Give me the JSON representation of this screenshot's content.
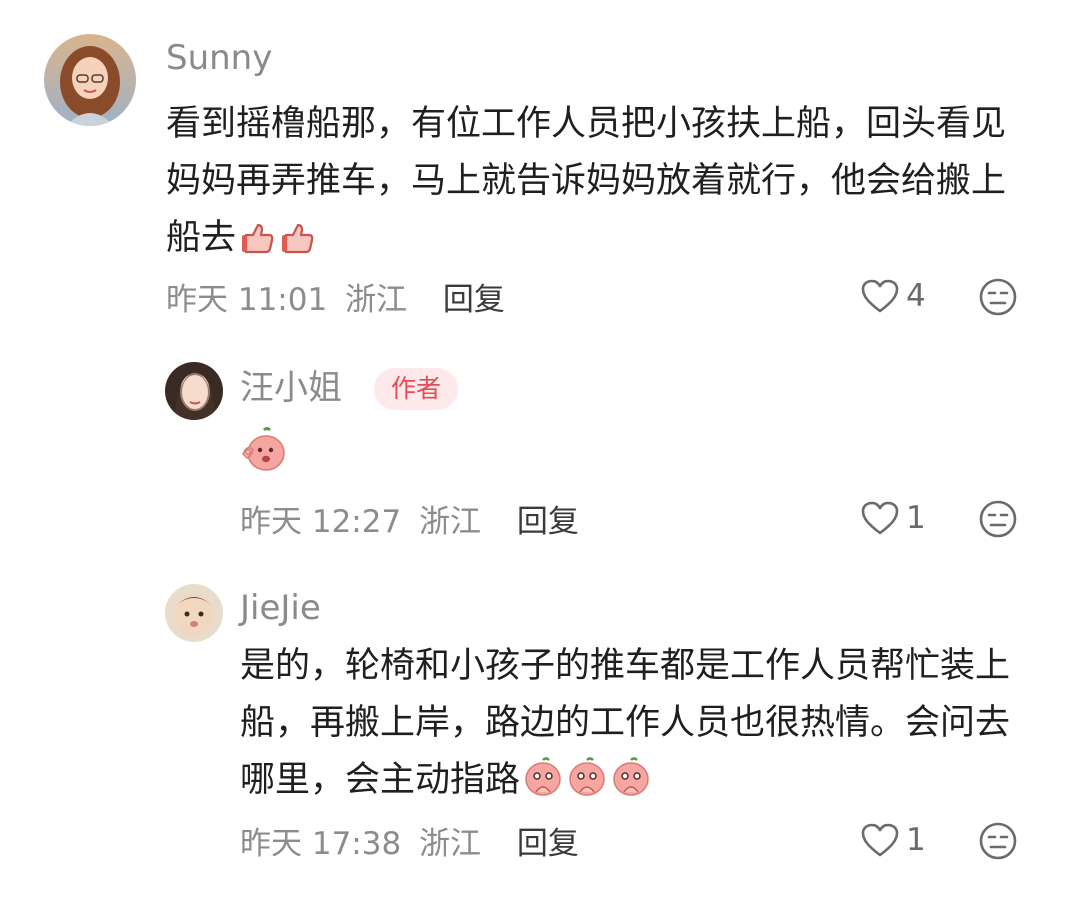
{
  "comments": [
    {
      "user": "Sunny",
      "text": "看到摇橹船那，有位工作人员把小孩扶上船，回头看见妈妈再弄推车，马上就告诉妈妈放着就行，他会给搬上船去",
      "time": "昨天 11:01",
      "location": "浙江",
      "reply_label": "回复",
      "likes": "4",
      "inline_emojis": [
        "thumbs-up",
        "thumbs-up"
      ]
    },
    {
      "user": "汪小姐",
      "badge": "作者",
      "sticker": "peach-ok",
      "time": "昨天 12:27",
      "location": "浙江",
      "reply_label": "回复",
      "likes": "1"
    },
    {
      "user": "JieJie",
      "text": "是的，轮椅和小孩子的推车都是工作人员帮忙装上船，再搬上岸，路边的工作人员也很热情。会问去哪里，会主动指路",
      "time": "昨天 17:38",
      "location": "浙江",
      "reply_label": "回复",
      "likes": "1",
      "inline_emojis": [
        "peach-pray",
        "peach-pray",
        "peach-pray"
      ]
    }
  ],
  "colors": {
    "badge_bg": "#fde9ea",
    "badge_text": "#e54b54",
    "peach": "#f6a6a0"
  }
}
